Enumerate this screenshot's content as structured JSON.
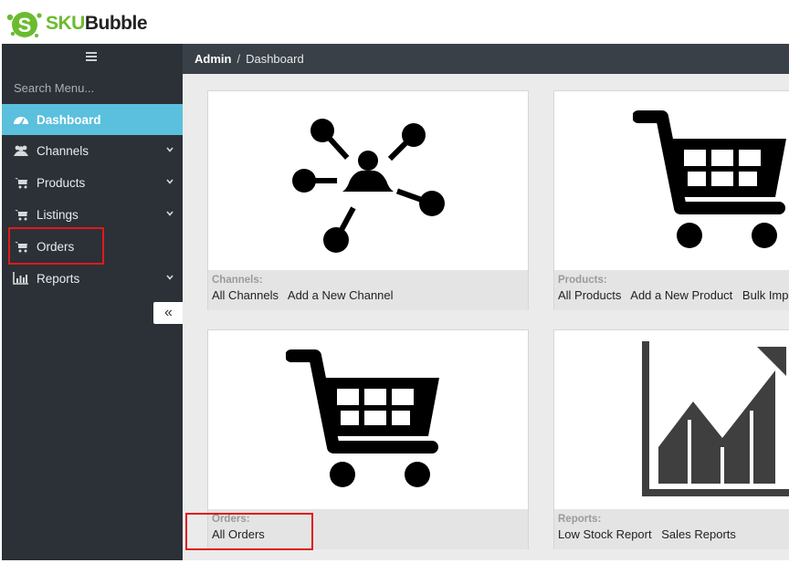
{
  "brand": {
    "logo_sku": "SKU",
    "logo_bubble": "Bubble",
    "logo_letter": "S",
    "accent": "#6bbb2f"
  },
  "sidebar": {
    "search_placeholder": "Search Menu...",
    "items": [
      {
        "label": "Dashboard",
        "icon": "dashboard-icon",
        "active": true,
        "expandable": false
      },
      {
        "label": "Channels",
        "icon": "users-icon",
        "active": false,
        "expandable": true
      },
      {
        "label": "Products",
        "icon": "cart-icon",
        "active": false,
        "expandable": true
      },
      {
        "label": "Listings",
        "icon": "cart-icon",
        "active": false,
        "expandable": true
      },
      {
        "label": "Orders",
        "icon": "cart-icon",
        "active": false,
        "expandable": false
      },
      {
        "label": "Reports",
        "icon": "bar-chart-icon",
        "active": false,
        "expandable": true
      }
    ],
    "collapse_glyph": "«"
  },
  "breadcrumb": {
    "root": "Admin",
    "separator": "/",
    "current": "Dashboard"
  },
  "cards": [
    {
      "title": "Channels:",
      "image": "network-icon",
      "links": [
        "All Channels",
        "Add a New Channel"
      ]
    },
    {
      "title": "Products:",
      "image": "shopping-cart-icon",
      "links": [
        "All Products",
        "Add a New Product",
        "Bulk Import"
      ]
    },
    {
      "title": "Orders:",
      "image": "shopping-cart-icon",
      "links": [
        "All Orders"
      ]
    },
    {
      "title": "Reports:",
      "image": "trending-chart-icon",
      "links": [
        "Low Stock Report",
        "Sales Reports"
      ]
    }
  ],
  "colors": {
    "sidebar_bg": "#2b3136",
    "topbar_bg": "#3a4047",
    "active_item": "#5bc0de",
    "highlight": "#e0191c"
  }
}
